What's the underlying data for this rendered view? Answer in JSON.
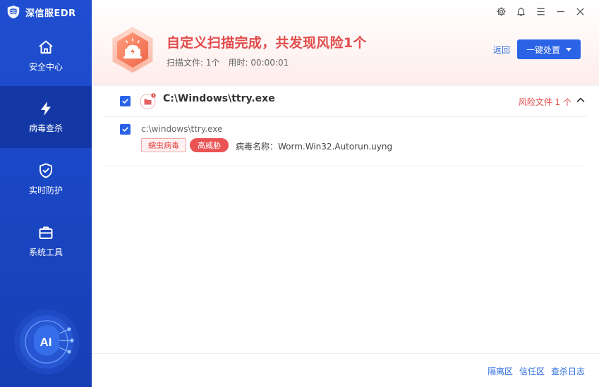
{
  "app": {
    "title": "深信服EDR"
  },
  "window_controls": {
    "icons": [
      "gear-icon",
      "bell-icon",
      "menu-icon",
      "minimize-icon",
      "close-icon"
    ]
  },
  "sidebar": {
    "items": [
      {
        "label": "安全中心",
        "icon": "home-icon",
        "active": false
      },
      {
        "label": "病毒查杀",
        "icon": "lightning-icon",
        "active": true
      },
      {
        "label": "实时防护",
        "icon": "shield-check-icon",
        "active": false
      },
      {
        "label": "系统工具",
        "icon": "toolbox-icon",
        "active": false
      }
    ],
    "ai_label": "AI"
  },
  "header": {
    "title": "自定义扫描完成，共发现风险1个",
    "scanned_files": "扫描文件: 1个",
    "elapsed": "用时: 00:00:01",
    "back_label": "返回",
    "action_button": "一键处置"
  },
  "results": {
    "group": {
      "path": "C:\\Windows\\ttry.exe",
      "risk_count": "风险文件 1 个"
    },
    "items": [
      {
        "path": "c:\\windows\\ttry.exe",
        "type_tag": "蠕虫病毒",
        "level_tag": "高威胁",
        "virus_name": "病毒名称：Worm.Win32.Autorun.uyng"
      }
    ]
  },
  "footer": {
    "links": [
      "隔离区",
      "信任区",
      "查杀日志"
    ]
  },
  "colors": {
    "sidebar": "#1f4fd0",
    "sidebar_active": "#1338a5",
    "accent": "#2b63e6",
    "danger": "#e24c4c",
    "link": "#2f6fe0"
  }
}
